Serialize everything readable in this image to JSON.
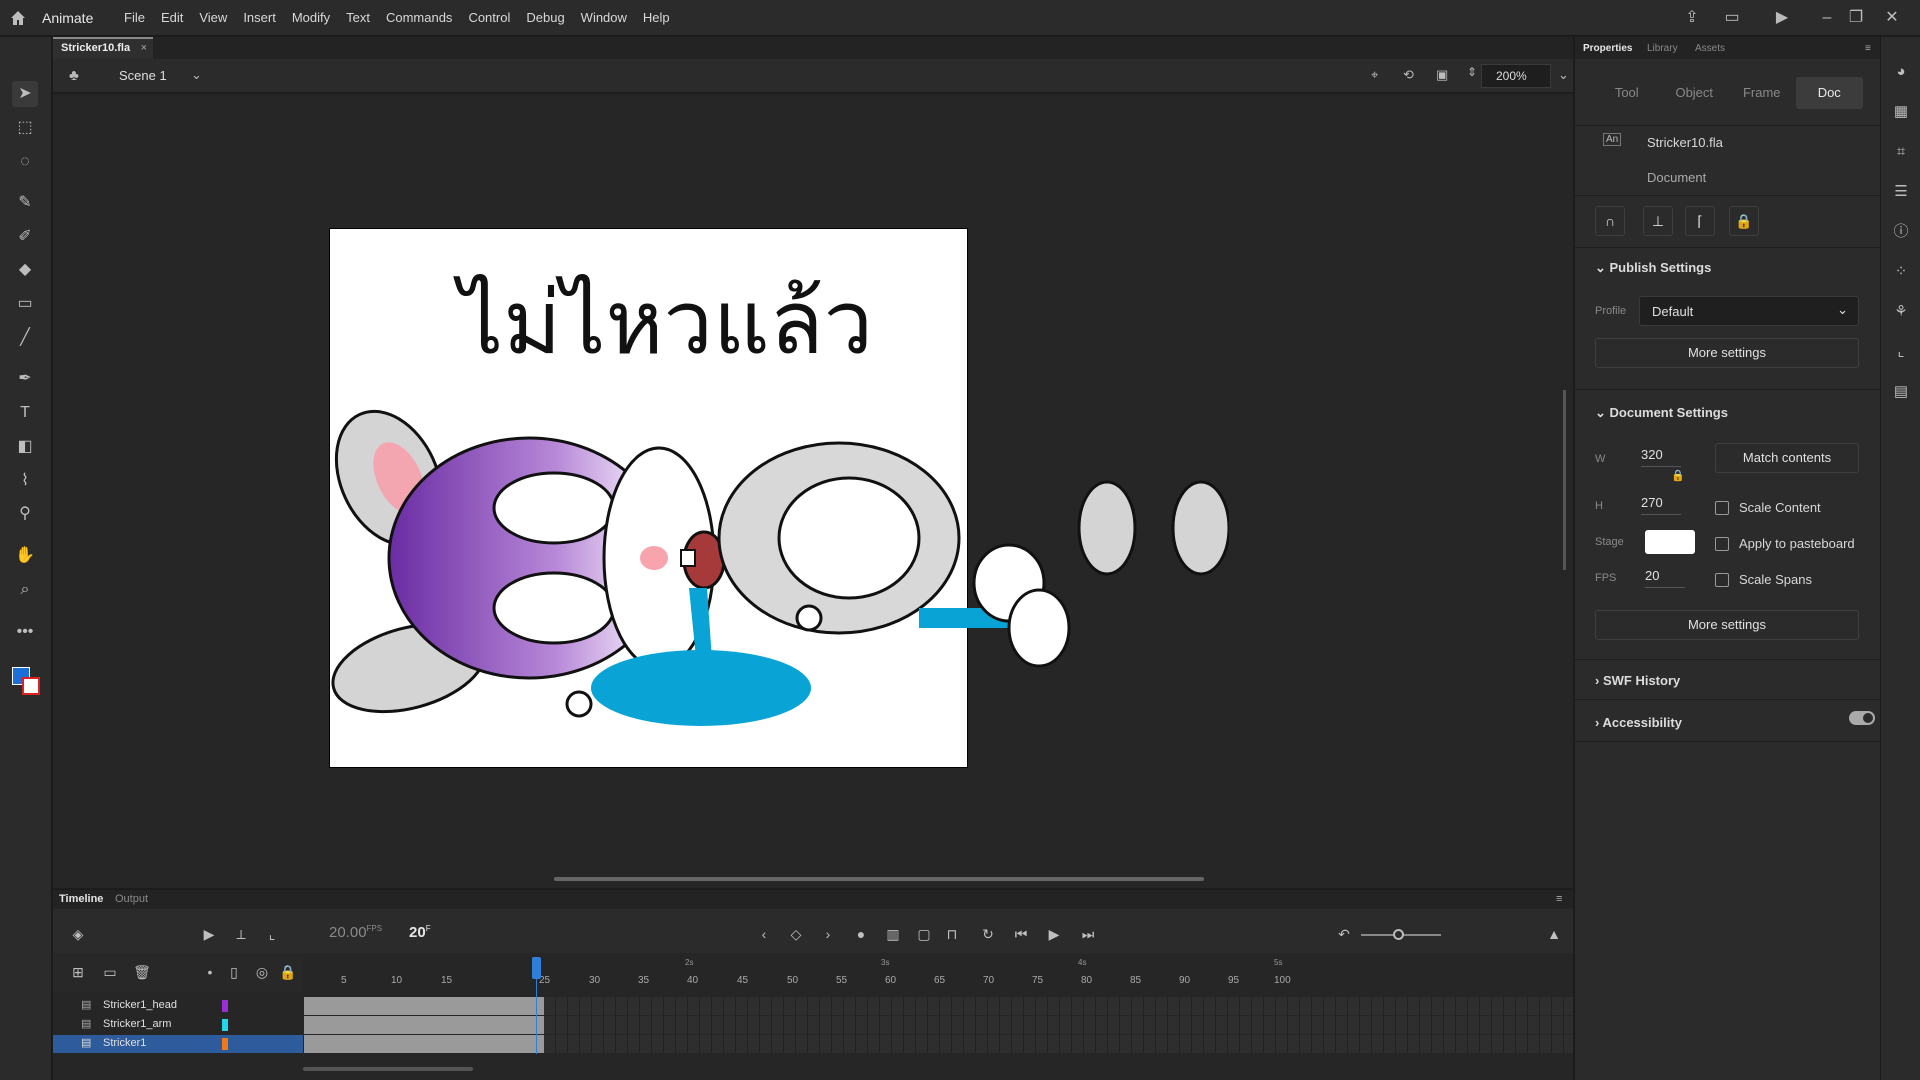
{
  "app": {
    "name": "Animate"
  },
  "menu": [
    "File",
    "Edit",
    "View",
    "Insert",
    "Modify",
    "Text",
    "Commands",
    "Control",
    "Debug",
    "Window",
    "Help"
  ],
  "document": {
    "tab_name": "Stricker10.fla",
    "close": "×"
  },
  "editbar": {
    "scene": "Scene 1",
    "zoom": "200%"
  },
  "stage": {
    "text": "ไม่ไหวแล้ว",
    "background": "#ffffff"
  },
  "timeline": {
    "tabs": [
      "Timeline",
      "Output"
    ],
    "fps_value": "20.00",
    "fps_unit": "FPS",
    "current_frame": "20",
    "frame_unit": "F",
    "ruler_ticks": [
      "5",
      "10",
      "15",
      "25",
      "30",
      "35",
      "40",
      "45",
      "50",
      "55",
      "60",
      "65",
      "70",
      "75",
      "80",
      "85",
      "90",
      "95",
      "100"
    ],
    "seconds": [
      "2s",
      "3s",
      "4s",
      "5s"
    ],
    "layers": [
      {
        "name": "Stricker1_head",
        "color": "#9b2fd6",
        "selected": false
      },
      {
        "name": "Stricker1_arm",
        "color": "#22d8e8",
        "selected": false
      },
      {
        "name": "Stricker1",
        "color": "#f07a1a",
        "selected": true
      }
    ]
  },
  "properties": {
    "tabs": [
      "Properties",
      "Library",
      "Assets"
    ],
    "segments": [
      "Tool",
      "Object",
      "Frame",
      "Doc"
    ],
    "active_segment": "Doc",
    "doc_name": "Stricker10.fla",
    "doc_type": "Document",
    "publish": {
      "title": "Publish Settings",
      "profile_label": "Profile",
      "profile_value": "Default",
      "more": "More settings"
    },
    "doc_settings": {
      "title": "Document Settings",
      "w_label": "W",
      "w": "320",
      "h_label": "H",
      "h": "270",
      "match": "Match contents",
      "scale_content": "Scale Content",
      "apply_pasteboard": "Apply to pasteboard",
      "scale_spans": "Scale Spans",
      "stage_label": "Stage",
      "fps_label": "FPS",
      "fps": "20",
      "more": "More settings"
    },
    "swf_history": "SWF History",
    "accessibility": "Accessibility"
  }
}
